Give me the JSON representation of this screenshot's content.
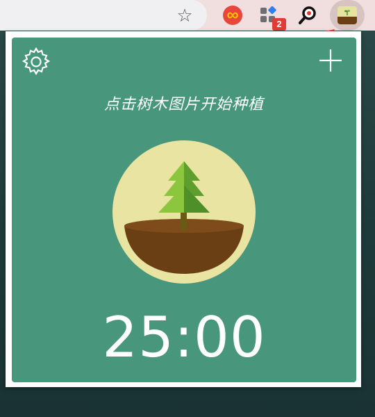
{
  "browser": {
    "toolbar": {
      "star_icon": "star-outline-icon",
      "extensions": [
        {
          "name": "infinity-extension",
          "icon": "infinity-icon",
          "color": "#e8453c"
        },
        {
          "name": "apps-extension",
          "icon": "apps-grid-icon",
          "badge": "2"
        },
        {
          "name": "magnifier-extension",
          "icon": "magnifier-icon"
        },
        {
          "name": "forest-extension",
          "icon": "forest-sprout-icon",
          "active": true
        }
      ]
    }
  },
  "popup": {
    "settings_icon": "gear-icon",
    "add_icon": "plus-icon",
    "hint": "点击树木图片开始种植",
    "timer": "25:00",
    "colors": {
      "panel": "#48977c",
      "circle": "#e9e4a1",
      "soil": "#6b3f14",
      "tree_light": "#8cc63f",
      "tree_dark": "#4f8f2a",
      "trunk": "#6b5a16",
      "arrow": "#e8392b"
    }
  }
}
